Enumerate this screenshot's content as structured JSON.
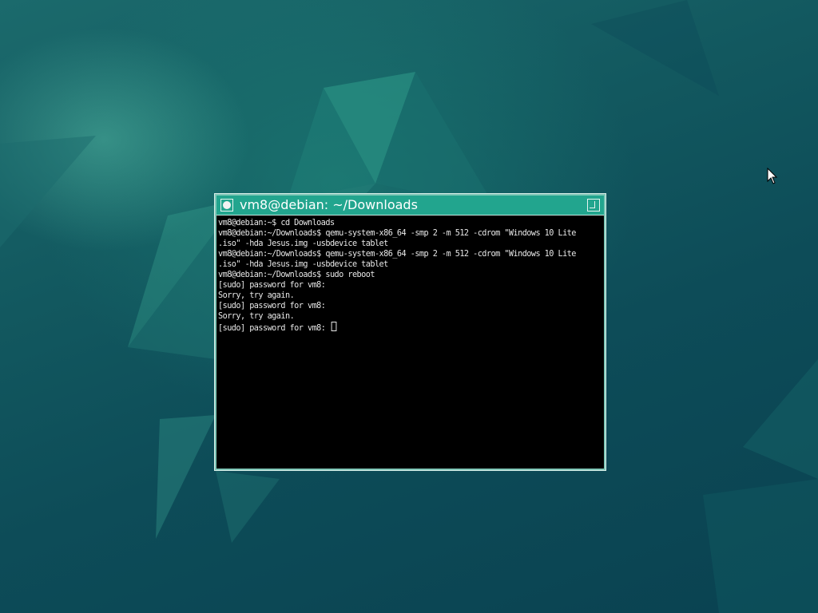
{
  "window": {
    "title": "vm8@debian: ~/Downloads"
  },
  "terminal": {
    "lines": [
      "vm8@debian:~$ cd Downloads",
      "vm8@debian:~/Downloads$ qemu-system-x86_64 -smp 2 -m 512 -cdrom \"Windows 10 Lite",
      ".iso\" -hda Jesus.img -usbdevice tablet",
      "vm8@debian:~/Downloads$ qemu-system-x86_64 -smp 2 -m 512 -cdrom \"Windows 10 Lite",
      ".iso\" -hda Jesus.img -usbdevice tablet",
      "vm8@debian:~/Downloads$ sudo reboot",
      "[sudo] password for vm8:",
      "Sorry, try again.",
      "[sudo] password for vm8:",
      "Sorry, try again.",
      "[sudo] password for vm8: "
    ]
  },
  "colors": {
    "titlebar": "#22a58e",
    "terminal_bg": "#000000",
    "terminal_fg": "#e8e8e8",
    "desktop": "#0d4c58"
  },
  "icons": {
    "window_menu": "circle-icon",
    "maximize": "maximize-icon",
    "pointer": "mouse-pointer-icon"
  }
}
